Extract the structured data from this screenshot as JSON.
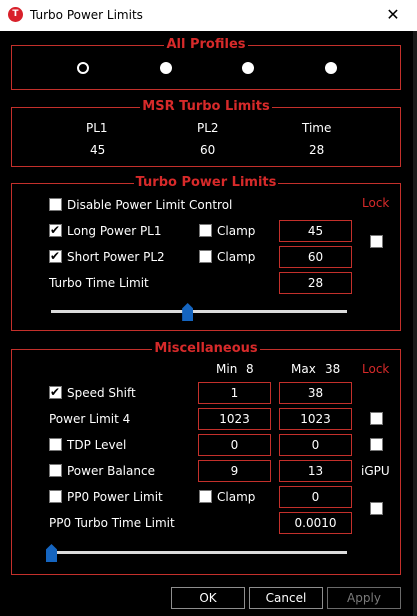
{
  "window": {
    "title": "Turbo Power Limits",
    "icon_letter": "T",
    "close_glyph": "✕"
  },
  "all_profiles": {
    "title": "All Profiles",
    "selected_index": 0,
    "profile_count": 4
  },
  "msr": {
    "title": "MSR Turbo Limits",
    "headers": [
      "PL1",
      "PL2",
      "Time"
    ],
    "values": [
      "45",
      "60",
      "28"
    ]
  },
  "turbo": {
    "title": "Turbo Power Limits",
    "disable_label": "Disable Power Limit Control",
    "disable_checked": false,
    "lock_label": "Lock",
    "lock_checked": false,
    "long_label": "Long Power PL1",
    "long_checked": true,
    "long_clamp_label": "Clamp",
    "long_clamp_checked": false,
    "long_value": "45",
    "short_label": "Short Power PL2",
    "short_checked": true,
    "short_clamp_label": "Clamp",
    "short_clamp_checked": false,
    "short_value": "60",
    "time_label": "Turbo Time Limit",
    "time_value": "28",
    "slider_fraction": 0.46
  },
  "misc": {
    "title": "Miscellaneous",
    "min_label": "Min",
    "min_value": "8",
    "max_label": "Max",
    "max_value": "38",
    "lock_label": "Lock",
    "speed_shift_label": "Speed Shift",
    "speed_shift_checked": true,
    "speed_shift_min": "1",
    "speed_shift_max": "38",
    "pl4_label": "Power Limit 4",
    "pl4_min": "1023",
    "pl4_max": "1023",
    "pl4_lock_checked": false,
    "tdp_label": "TDP Level",
    "tdp_checked": false,
    "tdp_min": "0",
    "tdp_max": "0",
    "tdp_lock_checked": false,
    "power_balance_label": "Power Balance",
    "power_balance_checked": false,
    "power_balance_min": "9",
    "power_balance_max": "13",
    "igpu_label": "iGPU",
    "pp0_label": "PP0 Power Limit",
    "pp0_checked": false,
    "pp0_clamp_label": "Clamp",
    "pp0_clamp_checked": false,
    "pp0_value": "0",
    "pp0_lock_checked": false,
    "pp0_time_label": "PP0 Turbo Time Limit",
    "pp0_time_value": "0.0010",
    "slider_fraction": 0.0
  },
  "buttons": {
    "ok": "OK",
    "cancel": "Cancel",
    "apply": "Apply"
  }
}
